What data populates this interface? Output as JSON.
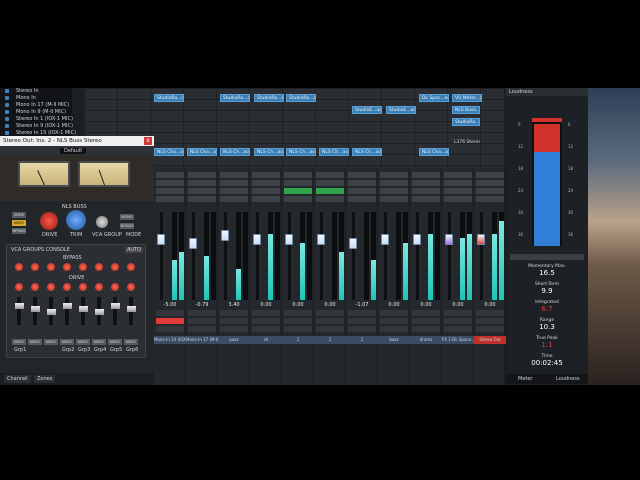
{
  "input_list": {
    "items": [
      "Stereo In",
      "Mono In",
      "Mono In 17 (M-II MIC)",
      "Mono In 9 (M-II MIC)",
      "Stereo In 1 (IOX-1 MIC)",
      "Stereo In 9 (IOX-1 MIC)",
      "Stereo In 15 (IOX-1 MIC)"
    ]
  },
  "plugin": {
    "title": "Stereo Out: Ins. 2 - NLS Buss Stereo",
    "close": "x",
    "preset": "Default",
    "logo": "NLS BUSS",
    "buttons": {
      "spike": "SPIKE",
      "nevo": "NEVO",
      "bypass": "BYPASS",
      "model": "STEREO"
    },
    "knob_labels": [
      "DRIVE",
      "TRIM",
      "VCA GROUP"
    ],
    "side_buttons": [
      "MONO",
      "BYPASS",
      "MODE"
    ],
    "vca_title": "VCA GROUPS CONSOLE",
    "vca_auto": "AUTO",
    "vca_sub": "BYPASS",
    "vca_drive": "DRIVE",
    "channel_labels": [
      "NEVO",
      "NEVO",
      "NEVO",
      "NEVO",
      "NEVO",
      "NEVO",
      "NEVO",
      "NEVO"
    ],
    "channel_groups": [
      "Grp1",
      "",
      "",
      "Grp2",
      "Grp3",
      "Grp4",
      "Grp5",
      "Grp6"
    ],
    "tabs": [
      "Channel",
      "Zones"
    ]
  },
  "arrange": {
    "clips": [
      "StudioRa...ao",
      "StudioRa...ao",
      "StudioRa...ao",
      "StudioRa...ao",
      "StudioE...ao",
      "StudioE...ao",
      "DL Spac...ed",
      "VU Meter...ao",
      "NLS Buss...",
      "StudioRa...ao",
      "NLS Cha...ao",
      "NLS Cha...ao",
      "NLS Ch...ao",
      "NLS Ch...ao",
      "NLS Ch...ao",
      "NLS Ch...ao",
      "NLS Ch...ao",
      "NLS Cha...ao"
    ],
    "stereo_label": "L376 Stereo"
  },
  "mixer": {
    "channels": [
      {
        "value": "-5.00",
        "name": "Mono In 14 (IOX..."
      },
      {
        "value": "-0.79",
        "name": "Mono In 17 (M-II..."
      },
      {
        "value": "3.40",
        "name": "pass"
      },
      {
        "value": "0.00",
        "name": "ch"
      },
      {
        "value": "0.00",
        "name": "1"
      },
      {
        "value": "0.00",
        "name": "1"
      },
      {
        "value": "-1.07",
        "name": "1"
      },
      {
        "value": "0.00",
        "name": "bass"
      },
      {
        "value": "0.00",
        "name": "drums"
      },
      {
        "value": "0.00",
        "name": "FX 1-DL Space..."
      },
      {
        "value": "0.00",
        "name": "Stereo Out"
      }
    ],
    "meter_levels": [
      0.45,
      0.5,
      0.35,
      0.75,
      0.65,
      0.0,
      0.0,
      0.0,
      0.75,
      0.7,
      0.75
    ],
    "second_meter": [
      0.55,
      0.0,
      0.0,
      0.0,
      0.0,
      0.55,
      0.45,
      0.65,
      0.0,
      0.75,
      0.9
    ],
    "fader_positions": [
      0.25,
      0.3,
      0.2,
      0.25,
      0.25,
      0.25,
      0.3,
      0.25,
      0.25,
      0.25,
      0.25
    ],
    "fader_colors": [
      "#c8dcf0",
      "#c8dcf0",
      "#c8dcf0",
      "#c8dcf0",
      "#c8dcf0",
      "#c8dcf0",
      "#c8dcf0",
      "#c8dcf0",
      "#c8dcf0",
      "#a070e0",
      "#e04040"
    ]
  },
  "loudness": {
    "header": "Loudness",
    "scale": [
      "6",
      "12",
      "18",
      "24",
      "30",
      "36"
    ],
    "momentary_max_label": "Momentary Max.",
    "momentary_max": "16.5",
    "short_term_label": "Short-Term",
    "short_term": "9.9",
    "integrated_label": "Integrated",
    "integrated": "6.7",
    "range_label": "Range",
    "range": "10.3",
    "true_peak_label": "True Peak",
    "true_peak": "1.1",
    "time_label": "Time",
    "time": "00:02:45",
    "unit": "LU",
    "bottom_tabs": [
      "Meter",
      "Loudness"
    ]
  },
  "colors": {
    "accent": "#3a7fb6",
    "meter": "#21c4b6",
    "warning": "#e23a3a",
    "loud_blue": "#2f7fd6",
    "loud_red": "#d2322a"
  }
}
